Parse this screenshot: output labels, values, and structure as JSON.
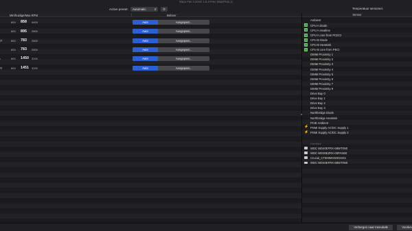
{
  "window": {
    "title": "Macs Fan Control 1.5.3 Free (MacPro6,1)"
  },
  "toolbar": {
    "preset_label": "Active preset:",
    "preset_value": "Automatic",
    "gear_symbol": "⚙"
  },
  "fans_table": {
    "header_rpm": "Min/huidige/Max RPM",
    "header_control": "Beheer",
    "auto_label": "Auto",
    "custom_label": "Aangepast...",
    "rows": [
      {
        "name": "",
        "min": "800",
        "current": "858",
        "max": "4400"
      },
      {
        "name": "",
        "min": "800",
        "current": "895",
        "max": "2800"
      },
      {
        "name": "ST",
        "min": "800",
        "current": "783",
        "max": "2800"
      },
      {
        "name": "",
        "min": "800",
        "current": "783",
        "max": "2800"
      },
      {
        "name": "A",
        "min": "800",
        "current": "1450",
        "max": "3200"
      },
      {
        "name": "T0",
        "min": "800",
        "current": "1451",
        "max": "3200"
      }
    ]
  },
  "sensors_panel": {
    "title": "Temperatuur sensoren:",
    "header": "Sensor",
    "ambient_label": "Ambient",
    "group_label": "Harddisk",
    "items": [
      {
        "label": "CPU A Diode",
        "icon": "chip"
      },
      {
        "label": "CPU A Heatline",
        "icon": "chip"
      },
      {
        "label": "CPU A core from PCECI",
        "icon": "chip"
      },
      {
        "label": "CPU B Diode",
        "icon": "chip"
      },
      {
        "label": "CPU B Heatsink",
        "icon": "chip"
      },
      {
        "label": "CPU B core from PECI",
        "icon": "chip"
      },
      {
        "label": "DIMM Proximity 1",
        "icon": ""
      },
      {
        "label": "DIMM Proximity 2",
        "icon": ""
      },
      {
        "label": "DIMM Proximity 3",
        "icon": ""
      },
      {
        "label": "DIMM Proximity 4",
        "icon": ""
      },
      {
        "label": "DIMM Proximity 5",
        "icon": ""
      },
      {
        "label": "DIMM Proximity 6",
        "icon": ""
      },
      {
        "label": "DIMM Proximity 7",
        "icon": ""
      },
      {
        "label": "DIMM Proximity 8",
        "icon": ""
      },
      {
        "label": "Drive Bay 0",
        "icon": ""
      },
      {
        "label": "Drive Bay 1",
        "icon": ""
      },
      {
        "label": "Drive Bay 2",
        "icon": ""
      },
      {
        "label": "Drive Bay 3",
        "icon": ""
      },
      {
        "label": "Northbridge Diode",
        "icon": ""
      },
      {
        "label": "Northbridge Heatsink",
        "icon": ""
      },
      {
        "label": "PCIE Ambient",
        "icon": ""
      },
      {
        "label": "PSMI Supply AC/DC Supply 1",
        "icon": "bolt"
      },
      {
        "label": "PSMI Supply AC/DC Supply 2",
        "icon": "bolt"
      }
    ],
    "disks": [
      {
        "label": "WDC WD40EFRX-68WT0N0",
        "icon": "disk"
      },
      {
        "label": "WDC WD30EZRX-00PASB0",
        "icon": "disk"
      },
      {
        "label": "Crucial_CT500MX500SSD1",
        "icon": "disk"
      },
      {
        "label": "WDC WD40EFRX-68WT0N0",
        "icon": "disk"
      }
    ]
  },
  "bottombar": {
    "hide_label": "Verbergen naar menubalk",
    "prefs_label": "Voorkeuren..."
  },
  "colors": {
    "auto_button": "#2a5fd6",
    "chip_icon": "#3ea33a",
    "power_icon": "#f0c419",
    "background": "#1b1b1d"
  }
}
